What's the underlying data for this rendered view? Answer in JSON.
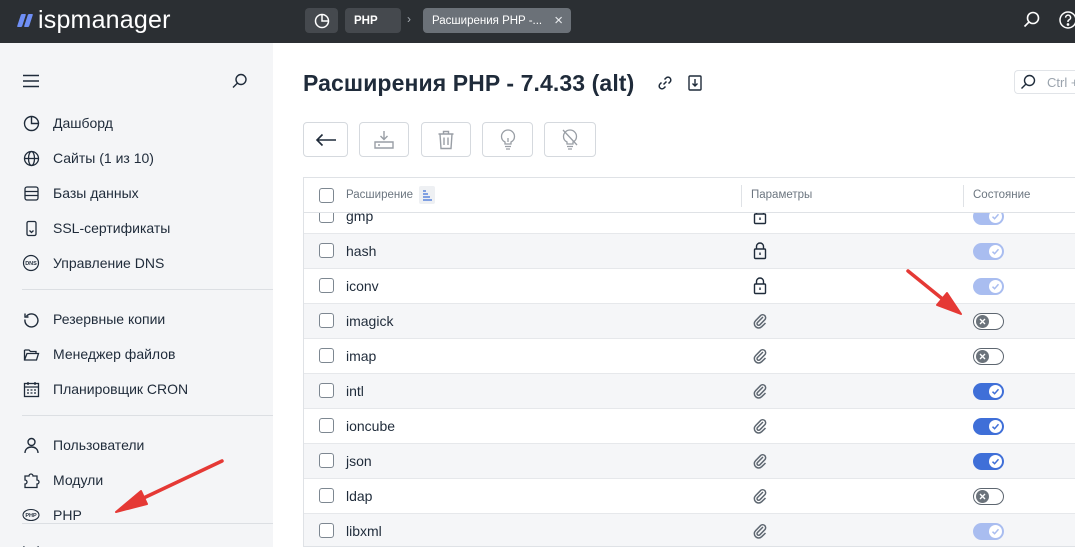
{
  "app": {
    "logo_text": "ispmanager"
  },
  "breadcrumbs": {
    "php": "PHP",
    "active": "Расширения PHP -..."
  },
  "sidebar": {
    "items": [
      {
        "label": "Дашборд",
        "icon": "dashboard-icon"
      },
      {
        "label": "Сайты (1 из 10)",
        "icon": "globe-icon"
      },
      {
        "label": "Базы данных",
        "icon": "database-icon"
      },
      {
        "label": "SSL-сертификаты",
        "icon": "certificate-icon"
      },
      {
        "label": "Управление DNS",
        "icon": "dns-icon"
      },
      {
        "label": "Резервные копии",
        "icon": "backup-icon"
      },
      {
        "label": "Менеджер файлов",
        "icon": "folder-icon"
      },
      {
        "label": "Планировщик CRON",
        "icon": "calendar-icon"
      },
      {
        "label": "Пользователи",
        "icon": "user-icon"
      },
      {
        "label": "Модули",
        "icon": "puzzle-icon"
      },
      {
        "label": "PHP",
        "icon": "php-icon"
      }
    ],
    "dns_badge": "DNS",
    "php_badge": "PHP"
  },
  "main": {
    "title": "Расширения PHP - 7.4.33 (alt)",
    "search_placeholder": "Ctrl +"
  },
  "table": {
    "columns": {
      "extension": "Расширение",
      "params": "Параметры",
      "state": "Состояние"
    },
    "rows": [
      {
        "name": "gmp",
        "param": "lock",
        "state": "on-locked"
      },
      {
        "name": "hash",
        "param": "lock",
        "state": "on-locked"
      },
      {
        "name": "iconv",
        "param": "lock",
        "state": "on-locked"
      },
      {
        "name": "imagick",
        "param": "clip",
        "state": "off"
      },
      {
        "name": "imap",
        "param": "clip",
        "state": "off"
      },
      {
        "name": "intl",
        "param": "clip",
        "state": "on"
      },
      {
        "name": "ioncube",
        "param": "clip",
        "state": "on"
      },
      {
        "name": "json",
        "param": "clip",
        "state": "on"
      },
      {
        "name": "ldap",
        "param": "clip",
        "state": "off"
      },
      {
        "name": "libxml",
        "param": "clip",
        "state": "on-locked"
      }
    ]
  },
  "colors": {
    "accent": "#3f6fd8",
    "accent_locked": "#a9bdf0",
    "topbar": "#2b2f33",
    "arrow": "#e53935"
  }
}
